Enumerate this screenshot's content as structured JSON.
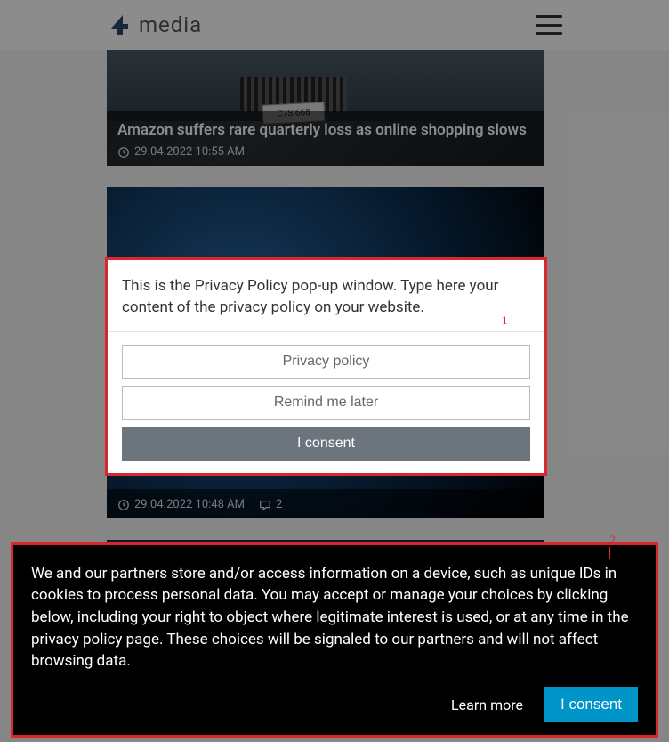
{
  "header": {
    "logo_text": "media",
    "logo_glyph": "4"
  },
  "articles": [
    {
      "title": "Amazon suffers rare quarterly loss as online shopping slows",
      "timestamp": "29.04.2022 10:55 AM",
      "comments": null
    },
    {
      "title": "",
      "timestamp": "29.04.2022 10:48 AM",
      "comments": "2"
    }
  ],
  "modal": {
    "body": "This is the Privacy Policy pop-up window. Type here your content of the privacy policy on your website.",
    "btn_policy": "Privacy policy",
    "btn_later": "Remind me later",
    "btn_consent": "I consent"
  },
  "banner": {
    "body": "We and our partners store and/or access information on a device, such as unique IDs in cookies to process personal data. You may accept or manage your choices by clicking below, including your right to object where legitimate interest is used, or at any time in the privacy policy page. These choices will be signaled to our partners and will not affect browsing data.",
    "learn_more": "Learn more",
    "consent": "I consent"
  },
  "annotations": {
    "a1": "1",
    "a2": "2"
  }
}
